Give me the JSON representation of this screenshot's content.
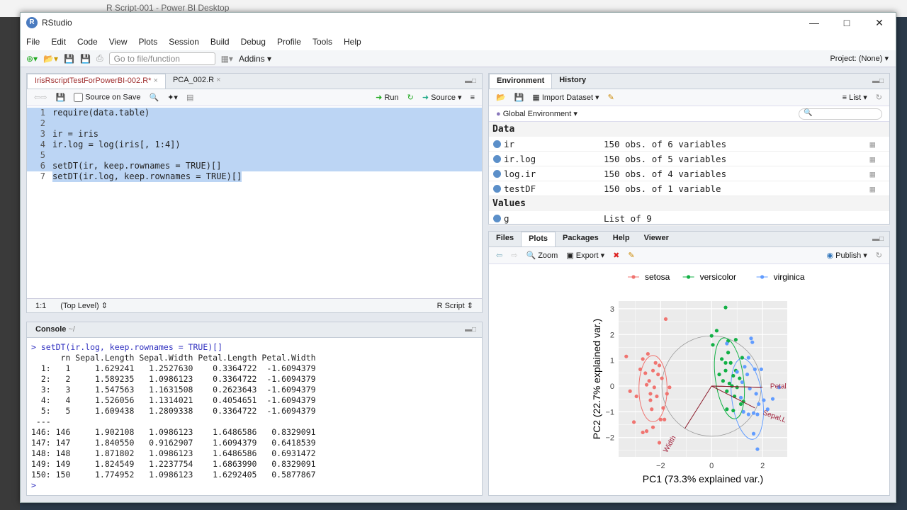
{
  "host": {
    "title": "R Script-001 - Power BI Desktop"
  },
  "app": {
    "title": "RStudio",
    "project": "Project: (None)"
  },
  "menu": [
    "File",
    "Edit",
    "Code",
    "View",
    "Plots",
    "Session",
    "Build",
    "Debug",
    "Profile",
    "Tools",
    "Help"
  ],
  "toolbar": {
    "goto_placeholder": "Go to file/function",
    "addins": "Addins"
  },
  "editor": {
    "tabs": [
      "IrisRscriptTestForPowerBI-002.R*",
      "PCA_002.R"
    ],
    "source_on_save": "Source on Save",
    "run": "Run",
    "source": "Source",
    "lines": [
      "require(data.table)",
      "",
      "ir = iris",
      "ir.log = log(iris[, 1:4])",
      "",
      "setDT(ir, keep.rownames = TRUE)[]",
      "setDT(ir.log, keep.rownames = TRUE)[]"
    ],
    "status": {
      "pos": "1:1",
      "scope": "(Top Level)",
      "type": "R Script"
    }
  },
  "console": {
    "title": "Console",
    "path": "~/",
    "lines": [
      "> setDT(ir.log, keep.rownames = TRUE)[]",
      "      rn Sepal.Length Sepal.Width Petal.Length Petal.Width",
      "  1:   1     1.629241   1.2527630    0.3364722  -1.6094379",
      "  2:   2     1.589235   1.0986123    0.3364722  -1.6094379",
      "  3:   3     1.547563   1.1631508    0.2623643  -1.6094379",
      "  4:   4     1.526056   1.1314021    0.4054651  -1.6094379",
      "  5:   5     1.609438   1.2809338    0.3364722  -1.6094379",
      " ---",
      "146: 146     1.902108   1.0986123    1.6486586   0.8329091",
      "147: 147     1.840550   0.9162907    1.6094379   0.6418539",
      "148: 148     1.871802   1.0986123    1.6486586   0.6931472",
      "149: 149     1.824549   1.2237754    1.6863990   0.8329091",
      "150: 150     1.774952   1.0986123    1.6292405   0.5877867"
    ],
    "prompt": ">"
  },
  "environment": {
    "tabs": [
      "Environment",
      "History"
    ],
    "import": "Import Dataset",
    "view": "List",
    "scope": "Global Environment",
    "data_header": "Data",
    "data": [
      {
        "name": "ir",
        "value": "150 obs. of 6 variables"
      },
      {
        "name": "ir.log",
        "value": "150 obs. of 5 variables"
      },
      {
        "name": "log.ir",
        "value": "150 obs. of 4 variables"
      },
      {
        "name": "testDF",
        "value": "150 obs. of 1 variable"
      }
    ],
    "values_header": "Values",
    "values": [
      {
        "name": "g",
        "value": "List of 9"
      }
    ]
  },
  "plots": {
    "tabs": [
      "Files",
      "Plots",
      "Packages",
      "Help",
      "Viewer"
    ],
    "zoom": "Zoom",
    "export": "Export",
    "publish": "Publish"
  },
  "chart_data": {
    "type": "scatter",
    "xlabel": "PC1 (73.3% explained var.)",
    "ylabel": "PC2 (22.7% explained var.)",
    "xlim": [
      -3.65,
      2.97
    ],
    "ylim": [
      -2.75,
      3.3
    ],
    "xticks": [
      -2,
      0,
      2
    ],
    "yticks": [
      3,
      2,
      1,
      0,
      -1,
      -2
    ],
    "series": [
      {
        "name": "setosa",
        "color": "#f07470",
        "points": [
          [
            -3.35,
            1.15
          ],
          [
            -3.2,
            -0.2
          ],
          [
            -3.05,
            -1.4
          ],
          [
            -2.95,
            -0.4
          ],
          [
            -2.8,
            0.65
          ],
          [
            -2.7,
            1.05
          ],
          [
            -2.6,
            0.5
          ],
          [
            -2.5,
            1.25
          ],
          [
            -2.45,
            0.2
          ],
          [
            -2.4,
            -0.3
          ],
          [
            -2.35,
            -0.9
          ],
          [
            -2.3,
            0.6
          ],
          [
            -2.25,
            -0.05
          ],
          [
            -2.2,
            0.9
          ],
          [
            -2.15,
            -0.4
          ],
          [
            -2.1,
            0.45
          ],
          [
            -2.05,
            0.8
          ],
          [
            -2.0,
            -1.3
          ],
          [
            -1.95,
            0.3
          ],
          [
            -1.9,
            -0.85
          ],
          [
            -1.85,
            -1.3
          ],
          [
            -1.75,
            -0.3
          ],
          [
            -1.65,
            -0.05
          ],
          [
            -2.55,
            -1.75
          ],
          [
            -2.7,
            -1.8
          ],
          [
            -2.05,
            -2.2
          ],
          [
            -1.8,
            2.6
          ],
          [
            -2.3,
            -1.6
          ],
          [
            -2.55,
            0.05
          ],
          [
            -2.4,
            -0.55
          ]
        ]
      },
      {
        "name": "versicolor",
        "color": "#12b045",
        "points": [
          [
            0.55,
            3.05
          ],
          [
            0.2,
            2.15
          ],
          [
            0.0,
            1.95
          ],
          [
            0.05,
            1.6
          ],
          [
            0.4,
            1.05
          ],
          [
            0.55,
            0.6
          ],
          [
            0.65,
            1.3
          ],
          [
            0.75,
            0.9
          ],
          [
            0.85,
            0.4
          ],
          [
            0.45,
            0.2
          ],
          [
            0.6,
            -0.2
          ],
          [
            0.7,
            0.1
          ],
          [
            0.9,
            -0.4
          ],
          [
            1.0,
            -0.05
          ],
          [
            1.1,
            0.3
          ],
          [
            1.15,
            -0.7
          ],
          [
            0.85,
            -0.95
          ],
          [
            0.6,
            -0.9
          ],
          [
            1.25,
            -0.6
          ],
          [
            0.3,
            0.45
          ],
          [
            0.95,
            1.8
          ],
          [
            0.65,
            1.75
          ],
          [
            1.2,
            1.1
          ],
          [
            0.8,
            0.0
          ],
          [
            0.55,
            0.9
          ],
          [
            0.95,
            0.6
          ]
        ]
      },
      {
        "name": "virginica",
        "color": "#619cff",
        "points": [
          [
            1.55,
            1.85
          ],
          [
            1.6,
            1.7
          ],
          [
            1.45,
            1.1
          ],
          [
            1.3,
            0.75
          ],
          [
            1.7,
            0.65
          ],
          [
            1.95,
            0.65
          ],
          [
            1.2,
            0.15
          ],
          [
            1.5,
            -0.1
          ],
          [
            1.75,
            -0.3
          ],
          [
            2.05,
            -0.55
          ],
          [
            2.4,
            -0.5
          ],
          [
            2.2,
            -0.9
          ],
          [
            1.85,
            -0.7
          ],
          [
            1.65,
            -1.05
          ],
          [
            1.45,
            -1.1
          ],
          [
            1.25,
            -1.0
          ],
          [
            1.8,
            -1.1
          ],
          [
            2.65,
            -0.05
          ],
          [
            1.65,
            -1.85
          ],
          [
            1.8,
            -2.45
          ],
          [
            1.0,
            0.55
          ],
          [
            1.15,
            -0.45
          ],
          [
            1.4,
            0.45
          ],
          [
            0.6,
            1.65
          ]
        ]
      }
    ],
    "loadings": [
      {
        "name": "Petal.Length",
        "x": 2.0,
        "y": -0.05
      },
      {
        "name": "Petal.Width",
        "x": 1.95,
        "y": -0.05
      },
      {
        "name": "Sepal.Length",
        "x": 1.7,
        "y": -0.85
      },
      {
        "name": "Sepal.Width",
        "x": -1.05,
        "y": -1.65
      }
    ],
    "loading_labels": [
      "Petal",
      "Sepal.L",
      "Width"
    ],
    "legend_position": "top"
  }
}
